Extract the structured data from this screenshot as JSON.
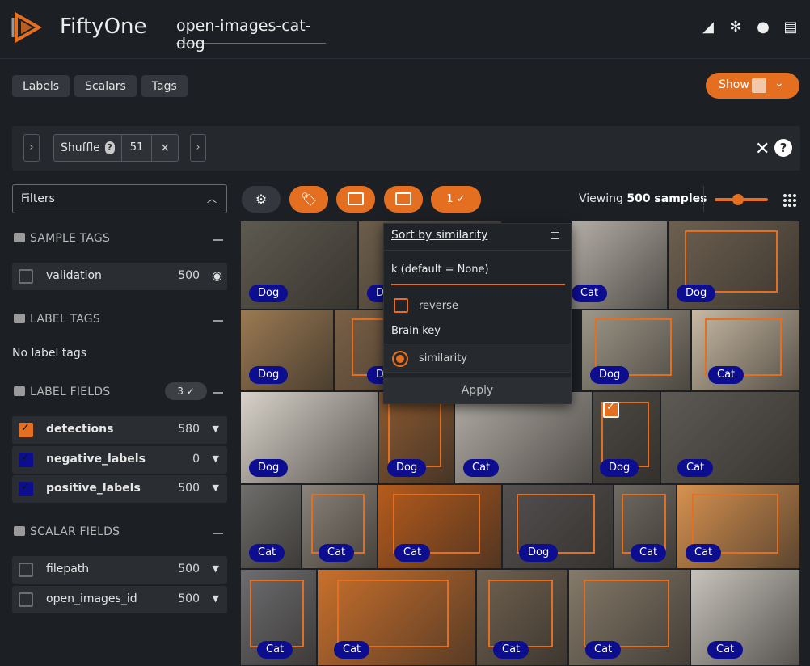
{
  "app": {
    "title": "FiftyOne",
    "dataset": "open-images-cat-dog",
    "header_icons": [
      "signal-icon",
      "slack-icon",
      "github-icon",
      "docs-icon"
    ]
  },
  "nav": {
    "buttons": [
      "Labels",
      "Scalars",
      "Tags"
    ],
    "show_label": "Show"
  },
  "view_bar": {
    "stage_name": "Shuffle",
    "stage_help": "?",
    "stage_value": "51",
    "stage_remove": "×",
    "close": "✕",
    "help": "?"
  },
  "sidebar": {
    "filters_label": "Filters",
    "sample_tags": {
      "title": "SAMPLE TAGS",
      "items": [
        {
          "label": "validation",
          "count": "500"
        }
      ]
    },
    "label_tags": {
      "title": "LABEL TAGS",
      "empty": "No label tags"
    },
    "label_fields": {
      "title": "LABEL FIELDS",
      "badge": "3 ✓",
      "items": [
        {
          "label": "detections",
          "count": "580",
          "color": "#e46f20"
        },
        {
          "label": "negative_labels",
          "count": "0",
          "color": "#0d0d8f"
        },
        {
          "label": "positive_labels",
          "count": "500",
          "color": "#0d0d8f"
        }
      ]
    },
    "scalar_fields": {
      "title": "SCALAR FIELDS",
      "items": [
        {
          "label": "filepath",
          "count": "500"
        },
        {
          "label": "open_images_id",
          "count": "500"
        }
      ]
    }
  },
  "toolbar": {
    "selected_badge": "1 ✓",
    "viewing_prefix": "Viewing",
    "viewing_count": "500 samples"
  },
  "popover": {
    "title": "Sort by similarity",
    "k_label": "k (default = None)",
    "reverse_label": "reverse",
    "brain_key_label": "Brain key",
    "brain_key_option": "similarity",
    "apply_label": "Apply"
  },
  "grid_labels": [
    "Dog",
    "Dog",
    "Cat",
    "Dog",
    "Dog",
    "Dog",
    "Dog",
    "Cat",
    "Dog",
    "Dog",
    "Cat",
    "Dog",
    "Cat",
    "Cat",
    "Cat",
    "Cat",
    "Dog",
    "Cat",
    "Cat",
    "Cat",
    "Cat",
    "Cat",
    "Cat",
    "Cat"
  ],
  "colors": {
    "accent": "#e46f20",
    "label_badge": "#0d0d8f",
    "background": "#1c1f24"
  }
}
